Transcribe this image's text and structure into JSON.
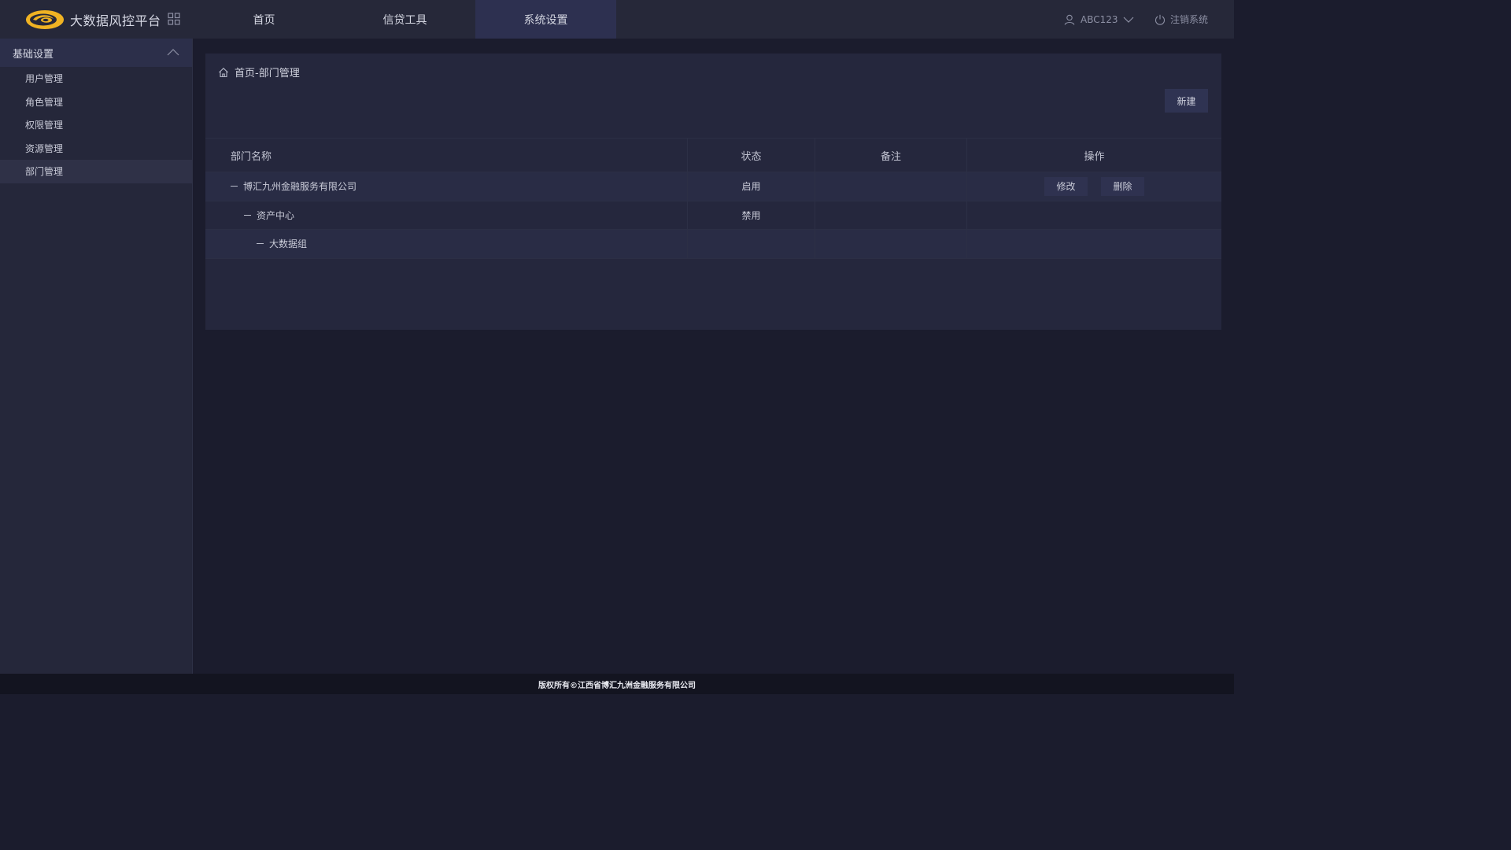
{
  "header": {
    "app_title": "大数据风控平台",
    "nav": [
      {
        "label": "首页"
      },
      {
        "label": "信贷工具"
      },
      {
        "label": "系统设置"
      }
    ],
    "user_name": "ABC123",
    "logout_label": "注销系统"
  },
  "sidebar": {
    "group_title": "基础设置",
    "items": [
      {
        "label": "用户管理"
      },
      {
        "label": "角色管理"
      },
      {
        "label": "权限管理"
      },
      {
        "label": "资源管理"
      },
      {
        "label": "部门管理"
      }
    ]
  },
  "main": {
    "breadcrumb": "首页-部门管理",
    "new_button": "新建",
    "table": {
      "headers": [
        "部门名称",
        "状态",
        "备注",
        "操作"
      ],
      "rows": [
        {
          "name": "博汇九州金融服务有限公司",
          "status": "启用",
          "note": "",
          "edit": "修改",
          "delete": "删除"
        },
        {
          "name": "资产中心",
          "status": "禁用",
          "note": ""
        },
        {
          "name": "大数据组",
          "status": "",
          "note": ""
        }
      ]
    }
  },
  "footer": {
    "copyright": "版权所有©江西省博汇九洲金融服务有限公司"
  },
  "colors": {
    "accent_logo_yellow": "#f0b323",
    "active_nav_bg": "#2d3050",
    "panel_bg": "#25273d"
  }
}
